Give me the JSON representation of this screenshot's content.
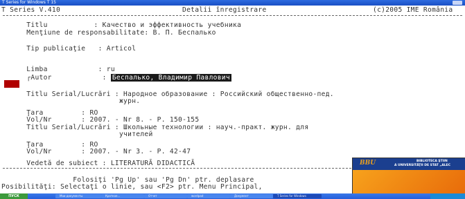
{
  "window": {
    "title": "T Series for Windows T 15"
  },
  "header": {
    "left": "T Series V.410",
    "center": "Detalii înregistrare",
    "right": "(c)2005 IME România"
  },
  "record": {
    "titlu": "    Titlu           : Качество и эффективность учебника",
    "mentiune": "    Menţiune de responsabilitate: В. П. Беспалько",
    "tip": "    Tip publicaţie   : Articol",
    "limba": "    Limba            : ru",
    "autor_label": "    ┌Autor            : ",
    "autor_value": "Беспалько, Владимир Павлович",
    "serial1": "    Titlu Serial/Lucrări : Народное образование : Российский общественно-пед.",
    "serial1_cont": "                          журн.",
    "tara1": "    Ţara         : RO",
    "vol1": "    Vol/Nr       : 2007. - Nr 8. - P. 150-155",
    "serial2": "    Titlu Serial/Lucrări : Школьные технологии : науч.-практ. журн. для",
    "serial2_cont": "                          учителей",
    "tara2": "    Ţara         : RO",
    "vol2": "    Vol/Nr       : 2007. - Nr 3. - P. 42-47",
    "vedeta": "    Vedetă de subiect : LITERATURĂ DIDACTICĂ"
  },
  "footer": {
    "line1": "                 Folosiţi 'Pg Up' sau 'Pg Dn' ptr. deplasare",
    "line2": "Posibilităţi: Selectaţi o linie, sau <F2> ptr. Menu Principal,"
  },
  "popup": {
    "logo": "BBU",
    "line1": "BIBLIOTECA ŞTIIN",
    "line2": "A UNIVERSITĂŢII DE STAT „ALEC"
  },
  "taskbar": {
    "start": "ПУСК",
    "items": [
      "Мои документы",
      "Краткое...",
      "Отчет",
      "wordpad",
      "Документ",
      "T Series for Windows"
    ]
  }
}
